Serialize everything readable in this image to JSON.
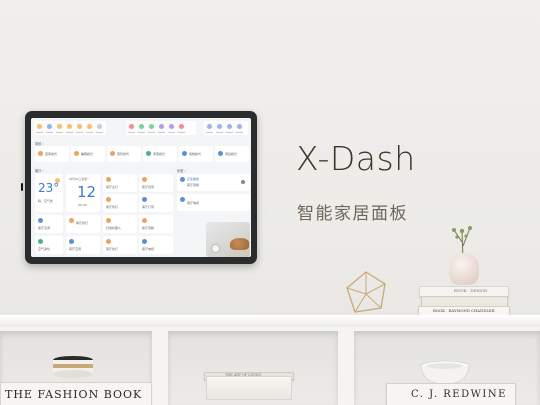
{
  "hero": {
    "title": "X-Dash",
    "subtitle": "智能家居面板"
  },
  "tablet": {
    "section_scenes": "场景 ›",
    "section_rooms": "客厅 ›",
    "section_right": "卧室 ›",
    "scenes": [
      {
        "icon": "home-icon",
        "color": "#f0a25a",
        "label": "回家模式"
      },
      {
        "icon": "sleep-icon",
        "color": "#f0a25a",
        "label": "睡眠模式"
      },
      {
        "icon": "movie-icon",
        "color": "#f0a25a",
        "label": "观影模式"
      },
      {
        "icon": "leave-icon",
        "color": "#4ab27e",
        "label": "离家模式"
      },
      {
        "icon": "meal-icon",
        "color": "#5b8fd6",
        "label": "用餐模式"
      },
      {
        "icon": "read-icon",
        "color": "#5b8fd6",
        "label": "阅读模式"
      }
    ],
    "weather": {
      "temp": "23°",
      "desc": "晴 · 空气优"
    },
    "clock": {
      "date": "01月01日 星期一",
      "time": "12",
      "sub": "00:00"
    },
    "controls": [
      {
        "label": "客厅主灯",
        "color": "#f0a25a"
      },
      {
        "label": "客厅空调",
        "color": "#5b8fd6"
      },
      {
        "label": "客厅窗帘",
        "color": "#f0a25a"
      },
      {
        "label": "客厅射灯",
        "color": "#f0a25a"
      },
      {
        "label": "客厅筒灯",
        "color": "#f0a25a"
      },
      {
        "label": "空气净化",
        "color": "#4ab27e"
      },
      {
        "label": "客厅灯带",
        "color": "#5b8fd6"
      },
      {
        "label": "扫地机器人",
        "color": "#f0a25a"
      },
      {
        "label": "客厅电视",
        "color": "#5b8fd6"
      },
      {
        "label": "客厅音箱",
        "color": "#f0a25a"
      }
    ],
    "media": {
      "title": "正在播放",
      "subtitle": "客厅音箱"
    },
    "brightness": "0"
  },
  "decor": {
    "book_left": "THE FASHION BOOK",
    "book_right": "C. J. REDWINE",
    "book_stack_a": "BOOK · DESIGN",
    "book_stack_b": "BOOK · RAYMOND CHANDLER",
    "book_mid": "THE ART OF LIVING"
  }
}
